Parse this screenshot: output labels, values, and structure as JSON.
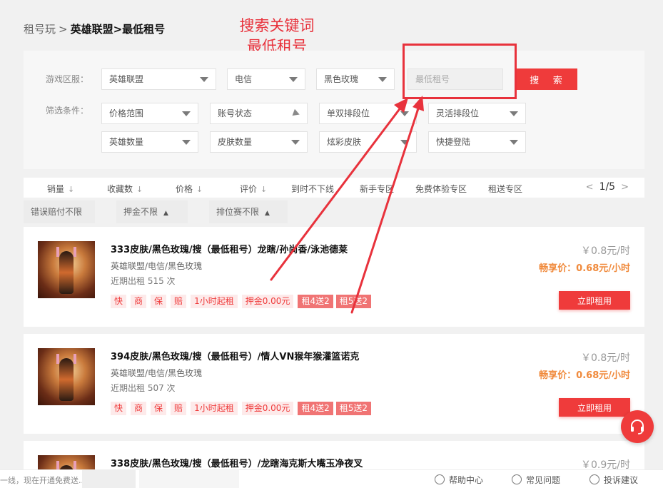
{
  "breadcrumb": {
    "root": "租号玩",
    "sep": ">",
    "current": "英雄联盟>最低租号"
  },
  "annotation": {
    "line1": "搜索关键词",
    "line2": "最低租号",
    "color": "#e8323c"
  },
  "filters": {
    "region_label": "游戏区服：",
    "condition_label": "筛选条件：",
    "selects": {
      "game": "英雄联盟",
      "isp": "电信",
      "server": "黑色玫瑰",
      "price_range": "价格范围",
      "account_status": "账号状态",
      "solo_rank": "单双排段位",
      "flex_rank": "灵活排段位",
      "hero_count": "英雄数量",
      "skin_count": "皮肤数量",
      "chroma_skin": "炫彩皮肤",
      "quick_login": "快捷登陆"
    },
    "search_placeholder": "最低租号",
    "search_button": "搜 索"
  },
  "sort_bar": {
    "items": [
      "销量",
      "收藏数",
      "价格",
      "评价",
      "到时不下线",
      "新手专区",
      "免费体验专区",
      "租送专区"
    ],
    "page": "1/5"
  },
  "sub_filters": [
    "错误赔付不限",
    "押金不限",
    "排位赛不限"
  ],
  "listings": [
    {
      "title": "333皮肤/黑色玫瑰/搜（最低租号）龙瞎/孙尚香/泳池德莱",
      "sub": "英雄联盟/电信/黑色玫瑰",
      "recent": "近期出租 515 次",
      "price": "￥0.8元/时",
      "enjoy_label": "畅享价：",
      "enjoy_value": "0.68元/小时",
      "tags": [
        "快",
        "商",
        "保",
        "赔",
        "1小时起租",
        "押金0.00元"
      ],
      "promo_tags": [
        "租4送2",
        "租5送2"
      ],
      "rent_button": "立即租用"
    },
    {
      "title": "394皮肤/黑色玫瑰/搜（最低租号）/情人VN猴年猴灌篮诺克",
      "sub": "英雄联盟/电信/黑色玫瑰",
      "recent": "近期出租 507 次",
      "price": "￥0.8元/时",
      "enjoy_label": "畅享价：",
      "enjoy_value": "0.68元/小时",
      "tags": [
        "快",
        "商",
        "保",
        "赔",
        "1小时起租",
        "押金0.00元"
      ],
      "promo_tags": [
        "租4送2",
        "租5送2"
      ],
      "rent_button": "立即租用"
    },
    {
      "title": "338皮肤/黑色玫瑰/搜（最低租号）/龙瞎海克斯大嘴玉净夜叉",
      "price": "￥0.9元/时"
    }
  ],
  "footer": {
    "left_text": "一线，现在开通免费送...",
    "links": [
      "帮助中心",
      "常见问题",
      "投诉建议"
    ]
  },
  "colors": {
    "accent": "#ef3b3b",
    "enjoy": "#f08a3c"
  }
}
